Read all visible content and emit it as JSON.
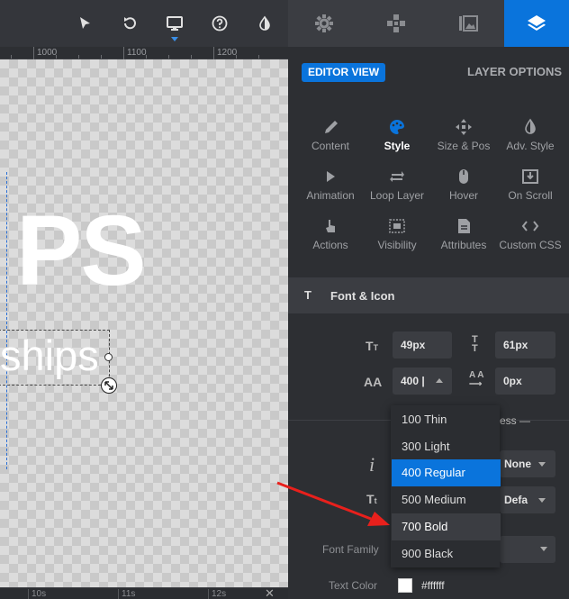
{
  "toolbar": {
    "icons": [
      "cursor-arrow-icon",
      "undo-icon",
      "monitor-icon",
      "help-icon",
      "contrast-icon"
    ]
  },
  "ruler": {
    "labels": [
      "1000",
      "1100",
      "1200"
    ]
  },
  "canvas": {
    "big_text": "PS",
    "sub_text": "ships"
  },
  "timeline": {
    "labels": [
      "10s",
      "11s",
      "12s"
    ]
  },
  "panel": {
    "tabs": [
      "settings-icon",
      "gamepad-icon",
      "images-icon",
      "layers-icon"
    ],
    "editor_view": "EDITOR VIEW",
    "layer_options": "LAYER OPTIONS",
    "options": [
      {
        "label": "Content",
        "icon": "pencil-icon"
      },
      {
        "label": "Style",
        "icon": "palette-icon",
        "active": true
      },
      {
        "label": "Size & Pos",
        "icon": "move-arrows-icon"
      },
      {
        "label": "Adv. Style",
        "icon": "contrast-icon"
      },
      {
        "label": "Animation",
        "icon": "play-icon"
      },
      {
        "label": "Loop Layer",
        "icon": "loop-icon"
      },
      {
        "label": "Hover",
        "icon": "mouse-icon"
      },
      {
        "label": "On Scroll",
        "icon": "scroll-download-icon"
      },
      {
        "label": "Actions",
        "icon": "pointer-hand-icon"
      },
      {
        "label": "Visibility",
        "icon": "visibility-icon"
      },
      {
        "label": "Attributes",
        "icon": "document-icon"
      },
      {
        "label": "Custom CSS",
        "icon": "code-icon"
      }
    ],
    "font_section": {
      "title": "Font & Icon",
      "font_size": "49px",
      "line_height": "61px",
      "font_weight_value": "400 |",
      "letter_spacing": "0px",
      "partial_text": "ess —",
      "italic_value": "None",
      "transform_value": "Defa",
      "font_family_label": "Font Family",
      "text_color_label": "Text Color",
      "text_color_value": "#ffffff"
    },
    "weight_options": [
      "100 Thin",
      "300 Light",
      "400 Regular",
      "500 Medium",
      "700 Bold",
      "900 Black"
    ],
    "selected_weight": "400 Regular",
    "hover_weight": "700 Bold"
  },
  "colors": {
    "accent": "#0a74dc",
    "panel_bg": "#2d2f33",
    "arrow": "#e8201c"
  }
}
